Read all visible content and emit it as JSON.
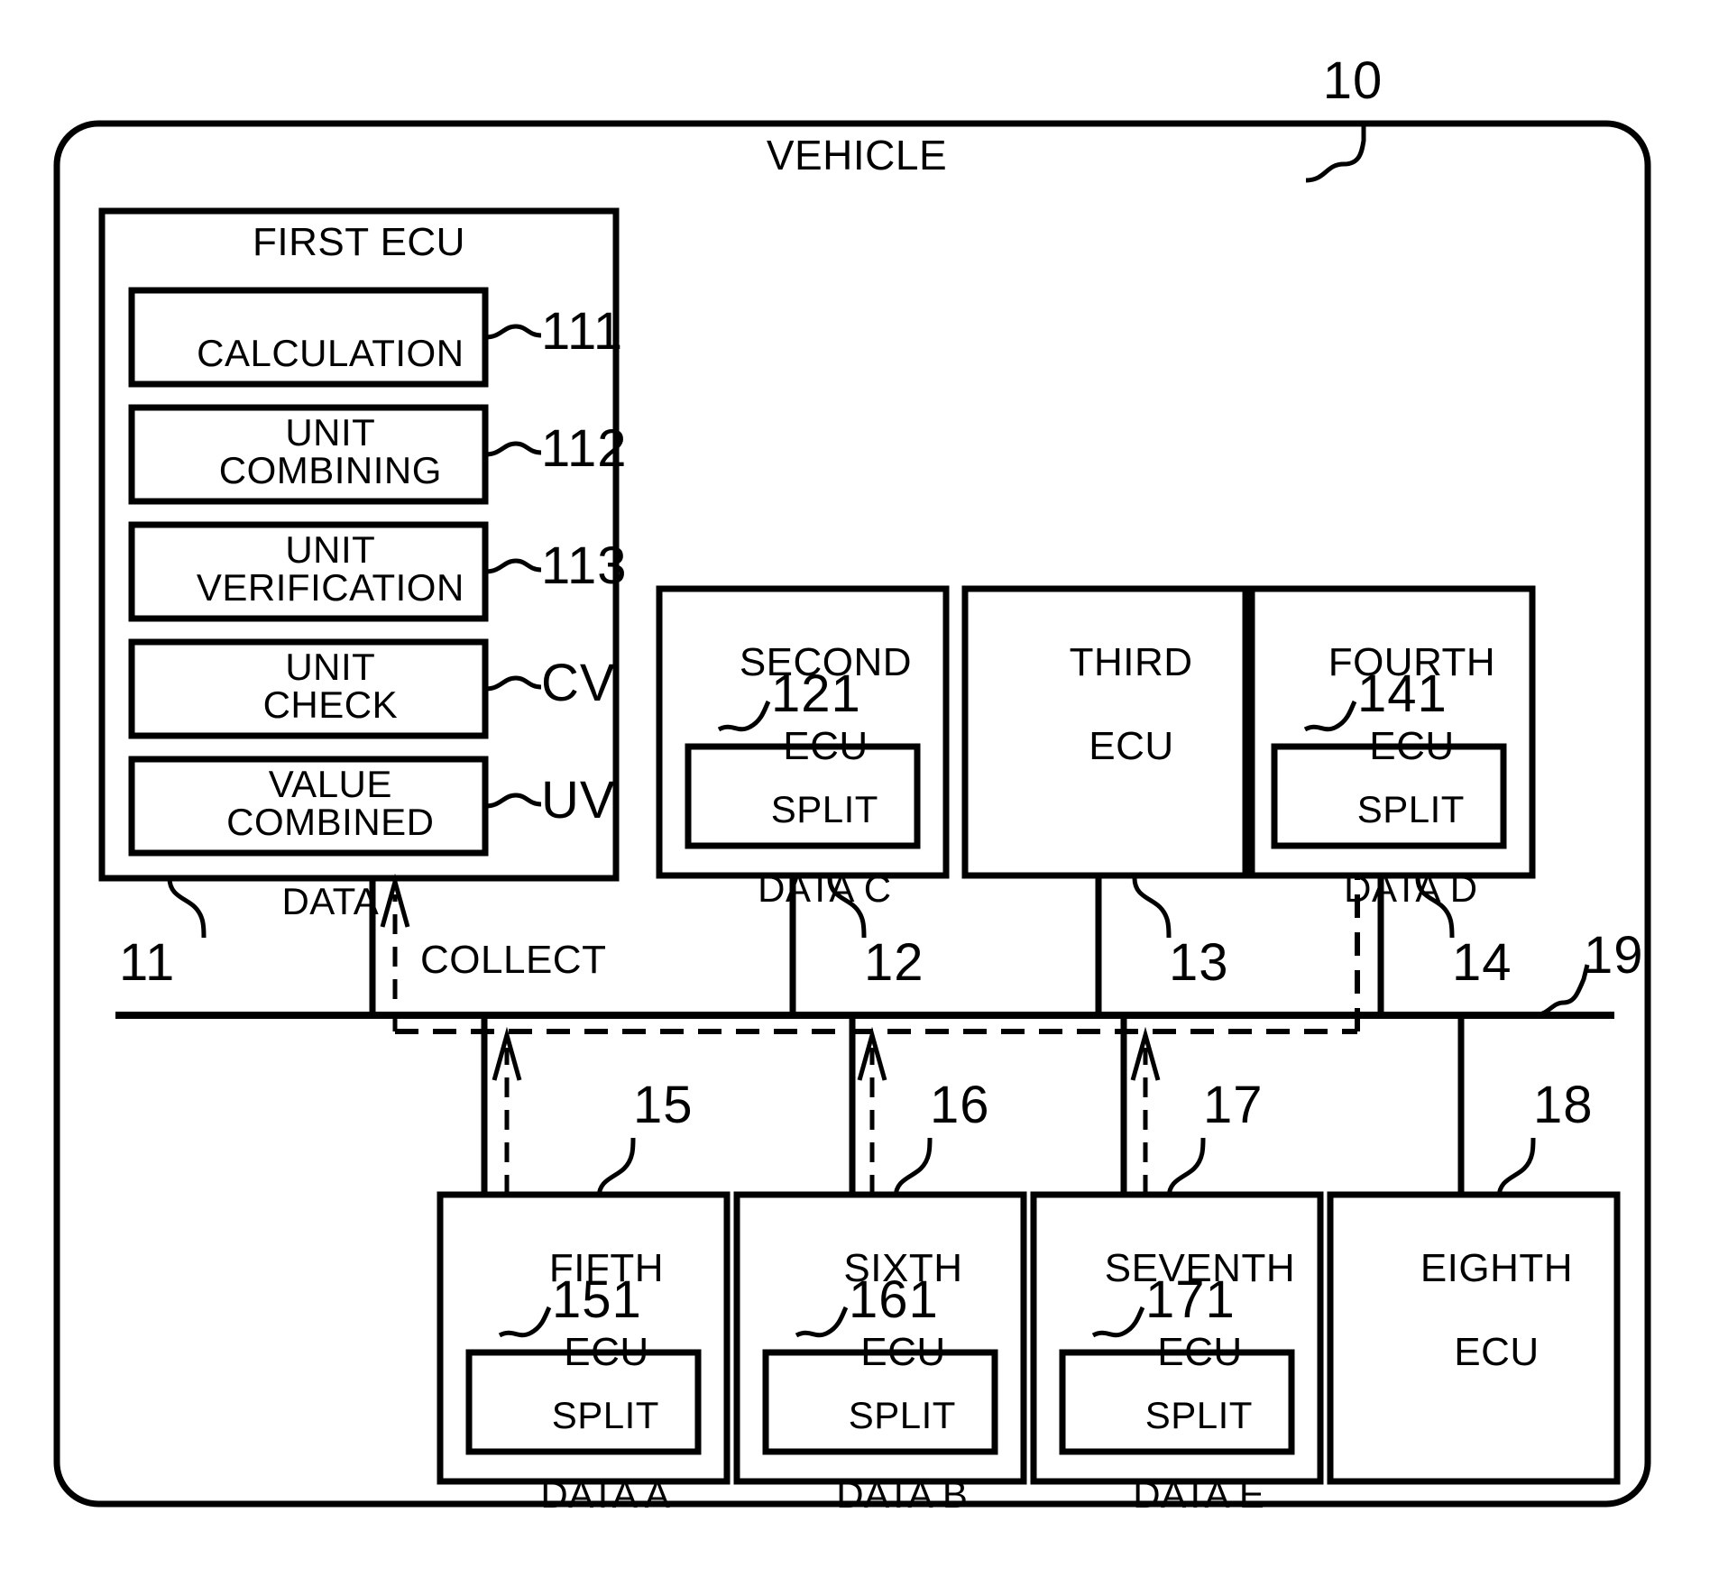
{
  "figure": {
    "outer_label": "VEHICLE",
    "outer_ref": "10",
    "bus_ref": "19",
    "collect_label": "COLLECT"
  },
  "first_ecu": {
    "title": "FIRST ECU",
    "ref": "11",
    "units": [
      {
        "line1": "CALCULATION",
        "line2": "UNIT",
        "ref": "111"
      },
      {
        "line1": "COMBINING",
        "line2": "UNIT",
        "ref": "112"
      },
      {
        "line1": "VERIFICATION",
        "line2": "UNIT",
        "ref": "113"
      },
      {
        "line1": "CHECK",
        "line2": "VALUE",
        "ref": "CV"
      },
      {
        "line1": "COMBINED",
        "line2": "DATA",
        "ref": "UV"
      }
    ]
  },
  "top_ecus": [
    {
      "title_line1": "SECOND",
      "title_line2": "ECU",
      "ref": "12",
      "inner_ref": "121",
      "inner_line1": "SPLIT",
      "inner_line2": "DATA C"
    },
    {
      "title_line1": "THIRD",
      "title_line2": "ECU",
      "ref": "13",
      "inner_ref": "",
      "inner_line1": "",
      "inner_line2": ""
    },
    {
      "title_line1": "FOURTH",
      "title_line2": "ECU",
      "ref": "14",
      "inner_ref": "141",
      "inner_line1": "SPLIT",
      "inner_line2": "DATA D"
    }
  ],
  "bottom_ecus": [
    {
      "title_line1": "FIFTH",
      "title_line2": "ECU",
      "ref": "15",
      "inner_ref": "151",
      "inner_line1": "SPLIT",
      "inner_line2": "DATA A"
    },
    {
      "title_line1": "SIXTH",
      "title_line2": "ECU",
      "ref": "16",
      "inner_ref": "161",
      "inner_line1": "SPLIT",
      "inner_line2": "DATA B"
    },
    {
      "title_line1": "SEVENTH",
      "title_line2": "ECU",
      "ref": "17",
      "inner_ref": "171",
      "inner_line1": "SPLIT",
      "inner_line2": "DATA E"
    },
    {
      "title_line1": "EIGHTH",
      "title_line2": "ECU",
      "ref": "18",
      "inner_ref": "",
      "inner_line1": "",
      "inner_line2": ""
    }
  ],
  "colors": {
    "stroke": "#000000",
    "background": "#ffffff"
  }
}
